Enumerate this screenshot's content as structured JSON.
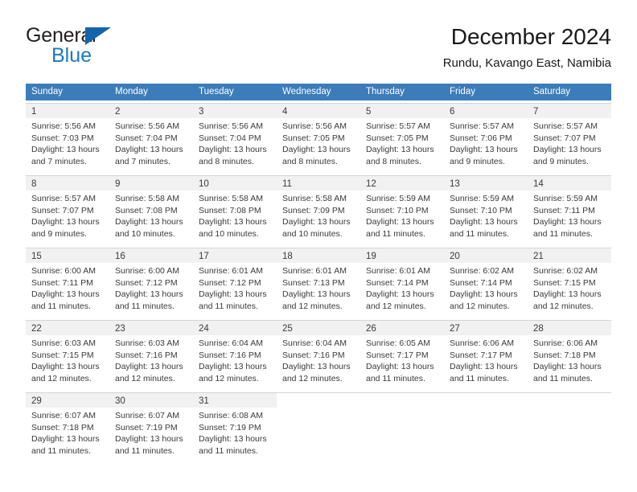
{
  "logo": {
    "word_one": "General",
    "word_two": "Blue",
    "triangle_color": "#1464aa",
    "blue_color": "#1b79c6"
  },
  "header": {
    "title": "December 2024",
    "subtitle": "Rundu, Kavango East, Namibia"
  },
  "theme": {
    "header_blue": "#3c7cba",
    "day_band_gray": "#f1f1f1",
    "border_gray": "#d4d4d4",
    "text_color": "#3a3a3a"
  },
  "calendar": {
    "weekdays": [
      "Sunday",
      "Monday",
      "Tuesday",
      "Wednesday",
      "Thursday",
      "Friday",
      "Saturday"
    ],
    "weeks": [
      [
        {
          "day": "1",
          "sunrise": "Sunrise: 5:56 AM",
          "sunset": "Sunset: 7:03 PM",
          "daylight_1": "Daylight: 13 hours",
          "daylight_2": "and 7 minutes."
        },
        {
          "day": "2",
          "sunrise": "Sunrise: 5:56 AM",
          "sunset": "Sunset: 7:04 PM",
          "daylight_1": "Daylight: 13 hours",
          "daylight_2": "and 7 minutes."
        },
        {
          "day": "3",
          "sunrise": "Sunrise: 5:56 AM",
          "sunset": "Sunset: 7:04 PM",
          "daylight_1": "Daylight: 13 hours",
          "daylight_2": "and 8 minutes."
        },
        {
          "day": "4",
          "sunrise": "Sunrise: 5:56 AM",
          "sunset": "Sunset: 7:05 PM",
          "daylight_1": "Daylight: 13 hours",
          "daylight_2": "and 8 minutes."
        },
        {
          "day": "5",
          "sunrise": "Sunrise: 5:57 AM",
          "sunset": "Sunset: 7:05 PM",
          "daylight_1": "Daylight: 13 hours",
          "daylight_2": "and 8 minutes."
        },
        {
          "day": "6",
          "sunrise": "Sunrise: 5:57 AM",
          "sunset": "Sunset: 7:06 PM",
          "daylight_1": "Daylight: 13 hours",
          "daylight_2": "and 9 minutes."
        },
        {
          "day": "7",
          "sunrise": "Sunrise: 5:57 AM",
          "sunset": "Sunset: 7:07 PM",
          "daylight_1": "Daylight: 13 hours",
          "daylight_2": "and 9 minutes."
        }
      ],
      [
        {
          "day": "8",
          "sunrise": "Sunrise: 5:57 AM",
          "sunset": "Sunset: 7:07 PM",
          "daylight_1": "Daylight: 13 hours",
          "daylight_2": "and 9 minutes."
        },
        {
          "day": "9",
          "sunrise": "Sunrise: 5:58 AM",
          "sunset": "Sunset: 7:08 PM",
          "daylight_1": "Daylight: 13 hours",
          "daylight_2": "and 10 minutes."
        },
        {
          "day": "10",
          "sunrise": "Sunrise: 5:58 AM",
          "sunset": "Sunset: 7:08 PM",
          "daylight_1": "Daylight: 13 hours",
          "daylight_2": "and 10 minutes."
        },
        {
          "day": "11",
          "sunrise": "Sunrise: 5:58 AM",
          "sunset": "Sunset: 7:09 PM",
          "daylight_1": "Daylight: 13 hours",
          "daylight_2": "and 10 minutes."
        },
        {
          "day": "12",
          "sunrise": "Sunrise: 5:59 AM",
          "sunset": "Sunset: 7:10 PM",
          "daylight_1": "Daylight: 13 hours",
          "daylight_2": "and 11 minutes."
        },
        {
          "day": "13",
          "sunrise": "Sunrise: 5:59 AM",
          "sunset": "Sunset: 7:10 PM",
          "daylight_1": "Daylight: 13 hours",
          "daylight_2": "and 11 minutes."
        },
        {
          "day": "14",
          "sunrise": "Sunrise: 5:59 AM",
          "sunset": "Sunset: 7:11 PM",
          "daylight_1": "Daylight: 13 hours",
          "daylight_2": "and 11 minutes."
        }
      ],
      [
        {
          "day": "15",
          "sunrise": "Sunrise: 6:00 AM",
          "sunset": "Sunset: 7:11 PM",
          "daylight_1": "Daylight: 13 hours",
          "daylight_2": "and 11 minutes."
        },
        {
          "day": "16",
          "sunrise": "Sunrise: 6:00 AM",
          "sunset": "Sunset: 7:12 PM",
          "daylight_1": "Daylight: 13 hours",
          "daylight_2": "and 11 minutes."
        },
        {
          "day": "17",
          "sunrise": "Sunrise: 6:01 AM",
          "sunset": "Sunset: 7:12 PM",
          "daylight_1": "Daylight: 13 hours",
          "daylight_2": "and 11 minutes."
        },
        {
          "day": "18",
          "sunrise": "Sunrise: 6:01 AM",
          "sunset": "Sunset: 7:13 PM",
          "daylight_1": "Daylight: 13 hours",
          "daylight_2": "and 12 minutes."
        },
        {
          "day": "19",
          "sunrise": "Sunrise: 6:01 AM",
          "sunset": "Sunset: 7:14 PM",
          "daylight_1": "Daylight: 13 hours",
          "daylight_2": "and 12 minutes."
        },
        {
          "day": "20",
          "sunrise": "Sunrise: 6:02 AM",
          "sunset": "Sunset: 7:14 PM",
          "daylight_1": "Daylight: 13 hours",
          "daylight_2": "and 12 minutes."
        },
        {
          "day": "21",
          "sunrise": "Sunrise: 6:02 AM",
          "sunset": "Sunset: 7:15 PM",
          "daylight_1": "Daylight: 13 hours",
          "daylight_2": "and 12 minutes."
        }
      ],
      [
        {
          "day": "22",
          "sunrise": "Sunrise: 6:03 AM",
          "sunset": "Sunset: 7:15 PM",
          "daylight_1": "Daylight: 13 hours",
          "daylight_2": "and 12 minutes."
        },
        {
          "day": "23",
          "sunrise": "Sunrise: 6:03 AM",
          "sunset": "Sunset: 7:16 PM",
          "daylight_1": "Daylight: 13 hours",
          "daylight_2": "and 12 minutes."
        },
        {
          "day": "24",
          "sunrise": "Sunrise: 6:04 AM",
          "sunset": "Sunset: 7:16 PM",
          "daylight_1": "Daylight: 13 hours",
          "daylight_2": "and 12 minutes."
        },
        {
          "day": "25",
          "sunrise": "Sunrise: 6:04 AM",
          "sunset": "Sunset: 7:16 PM",
          "daylight_1": "Daylight: 13 hours",
          "daylight_2": "and 12 minutes."
        },
        {
          "day": "26",
          "sunrise": "Sunrise: 6:05 AM",
          "sunset": "Sunset: 7:17 PM",
          "daylight_1": "Daylight: 13 hours",
          "daylight_2": "and 11 minutes."
        },
        {
          "day": "27",
          "sunrise": "Sunrise: 6:06 AM",
          "sunset": "Sunset: 7:17 PM",
          "daylight_1": "Daylight: 13 hours",
          "daylight_2": "and 11 minutes."
        },
        {
          "day": "28",
          "sunrise": "Sunrise: 6:06 AM",
          "sunset": "Sunset: 7:18 PM",
          "daylight_1": "Daylight: 13 hours",
          "daylight_2": "and 11 minutes."
        }
      ],
      [
        {
          "day": "29",
          "sunrise": "Sunrise: 6:07 AM",
          "sunset": "Sunset: 7:18 PM",
          "daylight_1": "Daylight: 13 hours",
          "daylight_2": "and 11 minutes."
        },
        {
          "day": "30",
          "sunrise": "Sunrise: 6:07 AM",
          "sunset": "Sunset: 7:19 PM",
          "daylight_1": "Daylight: 13 hours",
          "daylight_2": "and 11 minutes."
        },
        {
          "day": "31",
          "sunrise": "Sunrise: 6:08 AM",
          "sunset": "Sunset: 7:19 PM",
          "daylight_1": "Daylight: 13 hours",
          "daylight_2": "and 11 minutes."
        },
        {
          "day": "",
          "sunrise": "",
          "sunset": "",
          "daylight_1": "",
          "daylight_2": ""
        },
        {
          "day": "",
          "sunrise": "",
          "sunset": "",
          "daylight_1": "",
          "daylight_2": ""
        },
        {
          "day": "",
          "sunrise": "",
          "sunset": "",
          "daylight_1": "",
          "daylight_2": ""
        },
        {
          "day": "",
          "sunrise": "",
          "sunset": "",
          "daylight_1": "",
          "daylight_2": ""
        }
      ]
    ]
  }
}
